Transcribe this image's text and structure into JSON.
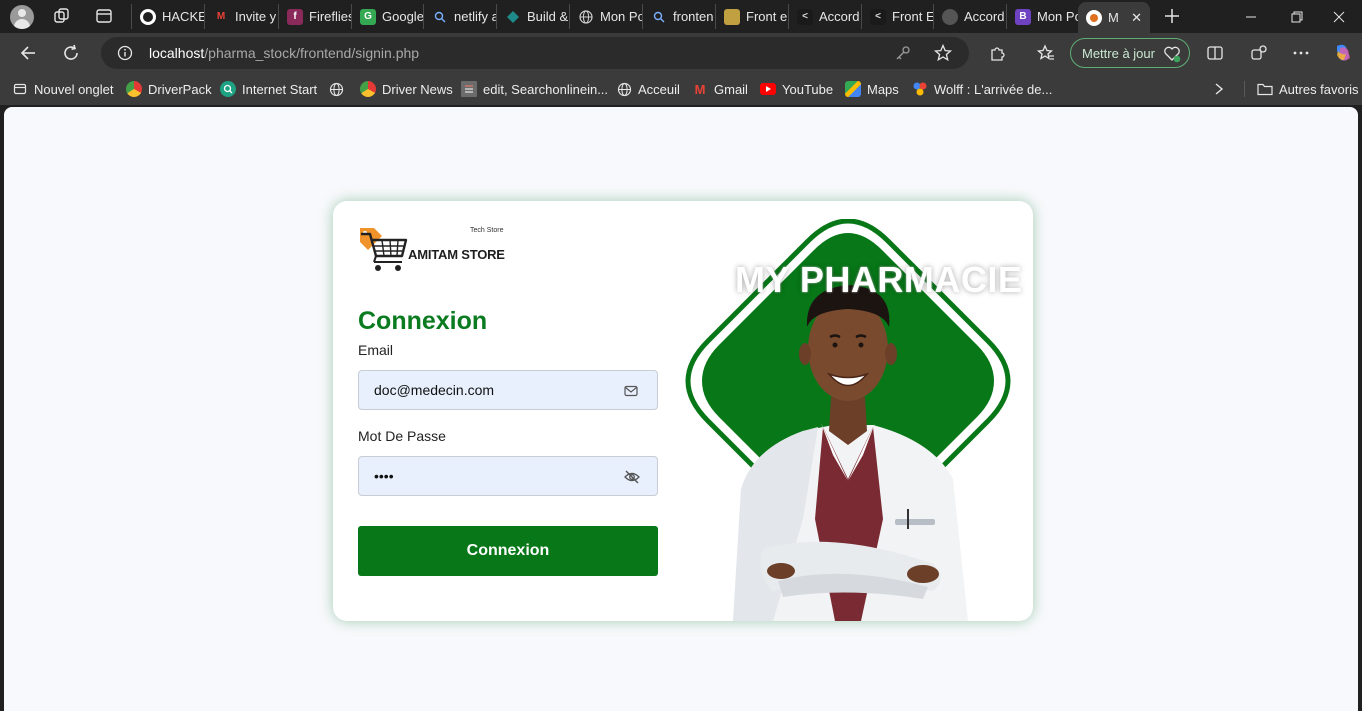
{
  "browser": {
    "tabs": [
      {
        "label": "HACKE",
        "icon": "github-icon"
      },
      {
        "label": "Invite y",
        "icon": "gmail-icon"
      },
      {
        "label": "Fireflies",
        "icon": "fireflies-icon"
      },
      {
        "label": "Google",
        "icon": "google-drive-icon"
      },
      {
        "label": "netlify a",
        "icon": "search-icon"
      },
      {
        "label": "Build &",
        "icon": "build-icon"
      },
      {
        "label": "Mon Po",
        "icon": "globe-icon"
      },
      {
        "label": "fronten",
        "icon": "search-icon"
      },
      {
        "label": "Front e",
        "icon": "folder-icon"
      },
      {
        "label": "Accord",
        "icon": "code-icon"
      },
      {
        "label": "Front E",
        "icon": "code-icon"
      },
      {
        "label": "Accord",
        "icon": "github-icon"
      },
      {
        "label": "Mon Po",
        "icon": "bootstrap-icon"
      },
      {
        "label": "M",
        "icon": "app-icon"
      }
    ],
    "address": {
      "host": "localhost",
      "path": "/pharma_stock/frontend/signin.php"
    },
    "update_button": "Mettre à jour",
    "bookmarks": [
      {
        "label": "Nouvel onglet",
        "icon": "tab-icon"
      },
      {
        "label": "DriverPack",
        "icon": "driverpack-icon"
      },
      {
        "label": "Internet Start",
        "icon": "search-icon"
      },
      {
        "label": "",
        "icon": "globe-icon"
      },
      {
        "label": "Driver News",
        "icon": "driverpack-icon"
      },
      {
        "label": "edit, Searchonlinein...",
        "icon": "document-icon"
      },
      {
        "label": "Acceuil",
        "icon": "globe-icon"
      },
      {
        "label": "Gmail",
        "icon": "gmail-icon"
      },
      {
        "label": "YouTube",
        "icon": "youtube-icon"
      },
      {
        "label": "Maps",
        "icon": "maps-icon"
      },
      {
        "label": "Wolff : L'arrivée de...",
        "icon": "app-icon"
      }
    ],
    "other_bookmarks": "Autres favoris"
  },
  "page": {
    "logo": {
      "tagline": "Tech Store",
      "brand": "AMITAM STORE"
    },
    "form": {
      "title": "Connexion",
      "email_label": "Email",
      "email_value": "doc@medecin.com",
      "password_label": "Mot De Passe",
      "password_value": "••••",
      "submit_label": "Connexion"
    },
    "hero": {
      "title": "MY PHARMACIE"
    }
  },
  "colors": {
    "primary_green": "#077717",
    "title_green": "#0a7b1f",
    "input_bg": "#e8f0fd",
    "logo_orange": "#f0932b"
  }
}
